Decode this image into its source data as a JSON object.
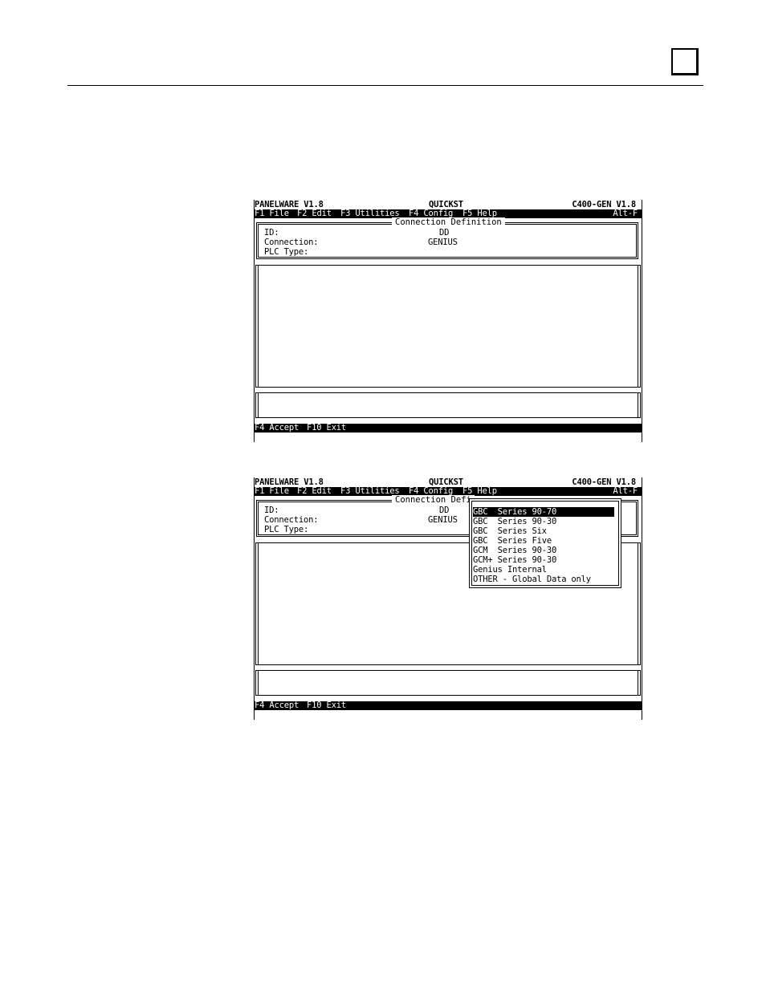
{
  "screens": [
    {
      "title_left": "PANELWARE V1.8",
      "title_center": "QUICKST",
      "title_right": "C400-GEN V1.8",
      "menu": {
        "f1": "F1 File",
        "f2": "F2 Edit",
        "f3": "F3 Utilities",
        "f4": "F4 Config",
        "f5": "F5 Help",
        "shortcut": "Alt-F"
      },
      "connection": {
        "title": "Connection Definition",
        "id_label": "ID:",
        "id_value": "DD",
        "connection_label": "Connection:",
        "connection_value": "GENIUS",
        "plc_label": "PLC Type:",
        "plc_value": ""
      },
      "footer": {
        "accept": "F4 Accept",
        "exit": "F10 Exit"
      }
    },
    {
      "title_left": "PANELWARE V1.8",
      "title_center": "QUICKST",
      "title_right": "C400-GEN V1.8",
      "menu": {
        "f1": "F1 File",
        "f2": "F2 Edit",
        "f3": "F3 Utilities",
        "f4": "F4 Config",
        "f5": "F5 Help",
        "shortcut": "Alt-F"
      },
      "connection": {
        "title": "Connection Defi",
        "id_label": "ID:",
        "id_value": "DD",
        "connection_label": "Connection:",
        "connection_value": "GENIUS",
        "plc_label": "PLC Type:",
        "plc_value": ""
      },
      "dropdown": {
        "selected_index": 0,
        "options": [
          "GBC  Series 90-70",
          "GBC  Series 90-30",
          "GBC  Series Six",
          "GBC  Series Five",
          "GCM  Series 90-30",
          "GCM+ Series 90-30",
          "Genius Internal",
          "OTHER - Global Data only"
        ]
      },
      "footer": {
        "accept": "F4 Accept",
        "exit": "F10 Exit"
      }
    }
  ]
}
